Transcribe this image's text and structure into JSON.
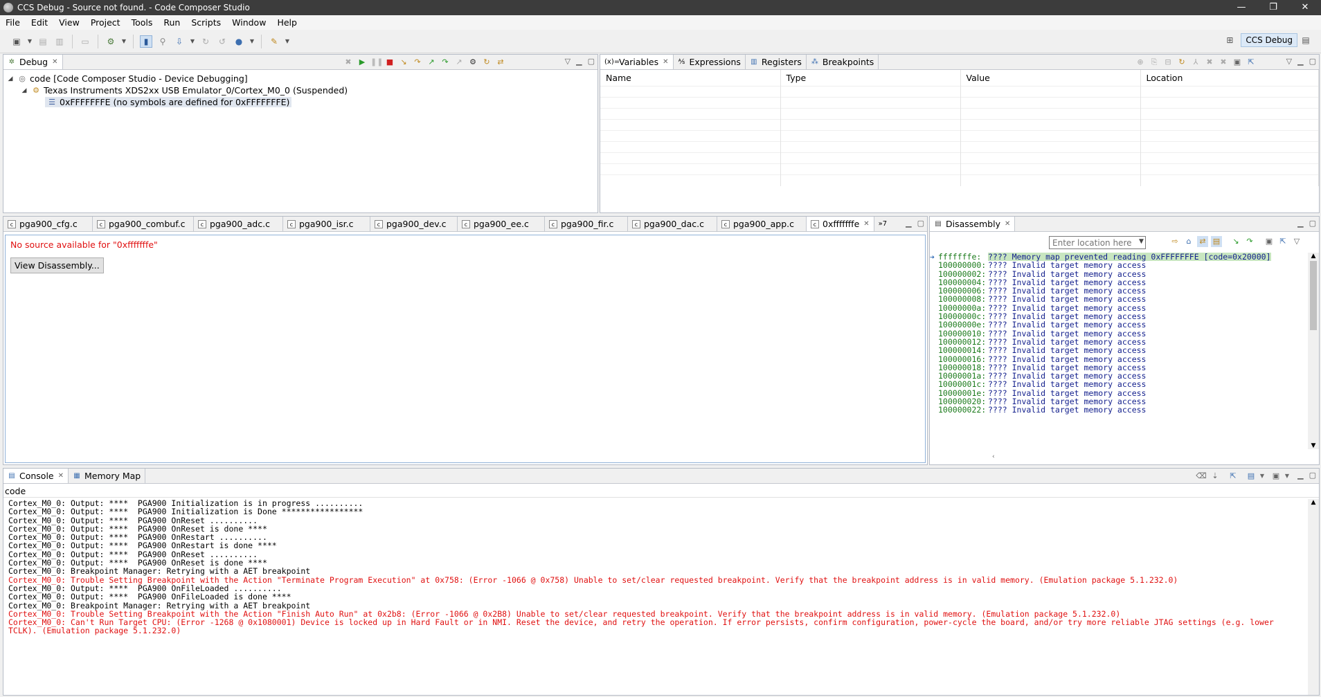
{
  "window": {
    "title": "CCS Debug - Source not found. - Code Composer Studio",
    "controls": [
      "—",
      "❐",
      "✕"
    ]
  },
  "menu": [
    "File",
    "Edit",
    "View",
    "Project",
    "Tools",
    "Run",
    "Scripts",
    "Window",
    "Help"
  ],
  "perspective": {
    "label": "CCS Debug"
  },
  "debug_view": {
    "tab": "Debug",
    "tree": [
      {
        "level": 0,
        "label": "code [Code Composer Studio - Device Debugging]"
      },
      {
        "level": 1,
        "label": "Texas Instruments XDS2xx USB Emulator_0/Cortex_M0_0 (Suspended)"
      },
      {
        "level": 2,
        "label": "0xFFFFFFFE  (no symbols are defined for 0xFFFFFFFE)"
      }
    ]
  },
  "variables_view": {
    "tabs": [
      "Variables",
      "Expressions",
      "Registers",
      "Breakpoints"
    ],
    "columns": [
      "Name",
      "Type",
      "Value",
      "Location"
    ]
  },
  "editor": {
    "tabs": [
      "pga900_cfg.c",
      "pga900_combuf.c",
      "pga900_adc.c",
      "pga900_isr.c",
      "pga900_dev.c",
      "pga900_ee.c",
      "pga900_fir.c",
      "pga900_dac.c",
      "pga900_app.c",
      "0xfffffffe"
    ],
    "overflow": "»7",
    "message": "No source available for \"0xfffffffe\"",
    "button": "View Disassembly..."
  },
  "disassembly": {
    "tab": "Disassembly",
    "location_placeholder": "Enter location here",
    "rows": [
      {
        "addr": "fffffffe:",
        "ins": "???? Memory map prevented reading 0xFFFFFFFE [code=0x20000]",
        "current": true
      },
      {
        "addr": "100000000:",
        "ins": "???? Invalid target memory access"
      },
      {
        "addr": "100000002:",
        "ins": "???? Invalid target memory access"
      },
      {
        "addr": "100000004:",
        "ins": "???? Invalid target memory access"
      },
      {
        "addr": "100000006:",
        "ins": "???? Invalid target memory access"
      },
      {
        "addr": "100000008:",
        "ins": "???? Invalid target memory access"
      },
      {
        "addr": "10000000a:",
        "ins": "???? Invalid target memory access"
      },
      {
        "addr": "10000000c:",
        "ins": "???? Invalid target memory access"
      },
      {
        "addr": "10000000e:",
        "ins": "???? Invalid target memory access"
      },
      {
        "addr": "100000010:",
        "ins": "???? Invalid target memory access"
      },
      {
        "addr": "100000012:",
        "ins": "???? Invalid target memory access"
      },
      {
        "addr": "100000014:",
        "ins": "???? Invalid target memory access"
      },
      {
        "addr": "100000016:",
        "ins": "???? Invalid target memory access"
      },
      {
        "addr": "100000018:",
        "ins": "???? Invalid target memory access"
      },
      {
        "addr": "10000001a:",
        "ins": "???? Invalid target memory access"
      },
      {
        "addr": "10000001c:",
        "ins": "???? Invalid target memory access"
      },
      {
        "addr": "10000001e:",
        "ins": "???? Invalid target memory access"
      },
      {
        "addr": "100000020:",
        "ins": "???? Invalid target memory access"
      },
      {
        "addr": "100000022:",
        "ins": "???? Invalid target memory access"
      }
    ]
  },
  "console": {
    "tabs": [
      "Console",
      "Memory Map"
    ],
    "name": "code",
    "lines": [
      {
        "text": "Cortex_M0_0: Output: ****  PGA900 Initialization is in progress ..........",
        "error": false
      },
      {
        "text": "Cortex_M0_0: Output: ****  PGA900 Initialization is Done *****************",
        "error": false
      },
      {
        "text": "Cortex_M0_0: Output: ****  PGA900 OnReset ..........",
        "error": false
      },
      {
        "text": "Cortex_M0_0: Output: ****  PGA900 OnReset is done ****",
        "error": false
      },
      {
        "text": "Cortex_M0_0: Output: ****  PGA900 OnRestart ..........",
        "error": false
      },
      {
        "text": "Cortex_M0_0: Output: ****  PGA900 OnRestart is done ****",
        "error": false
      },
      {
        "text": "Cortex_M0_0: Output: ****  PGA900 OnReset ..........",
        "error": false
      },
      {
        "text": "Cortex_M0_0: Output: ****  PGA900 OnReset is done ****",
        "error": false
      },
      {
        "text": "Cortex_M0_0: Breakpoint Manager: Retrying with a AET breakpoint",
        "error": false
      },
      {
        "text": "Cortex_M0_0: Trouble Setting Breakpoint with the Action \"Terminate Program Execution\" at 0x758: (Error -1066 @ 0x758) Unable to set/clear requested breakpoint. Verify that the breakpoint address is in valid memory. (Emulation package 5.1.232.0)",
        "error": true
      },
      {
        "text": "Cortex_M0_0: Output: ****  PGA900 OnFileLoaded ..........",
        "error": false
      },
      {
        "text": "Cortex_M0_0: Output: ****  PGA900 OnFileLoaded is done ****",
        "error": false
      },
      {
        "text": "Cortex_M0_0: Breakpoint Manager: Retrying with a AET breakpoint",
        "error": false
      },
      {
        "text": "Cortex_M0_0: Trouble Setting Breakpoint with the Action \"Finish Auto Run\" at 0x2b8: (Error -1066 @ 0x2B8) Unable to set/clear requested breakpoint. Verify that the breakpoint address is in valid memory. (Emulation package 5.1.232.0)",
        "error": true
      },
      {
        "text": "Cortex_M0_0: Can't Run Target CPU: (Error -1268 @ 0x1080001) Device is locked up in Hard Fault or in NMI. Reset the device, and retry the operation. If error persists, confirm configuration, power-cycle the board, and/or try more reliable JTAG settings (e.g. lower",
        "error": true
      },
      {
        "text": "TCLK). (Emulation package 5.1.232.0)",
        "error": true
      }
    ]
  },
  "colors": {
    "error": "#e01010",
    "addr": "#1a7a1a",
    "ins": "#111e8c",
    "current_line": "#c8e6c0"
  }
}
